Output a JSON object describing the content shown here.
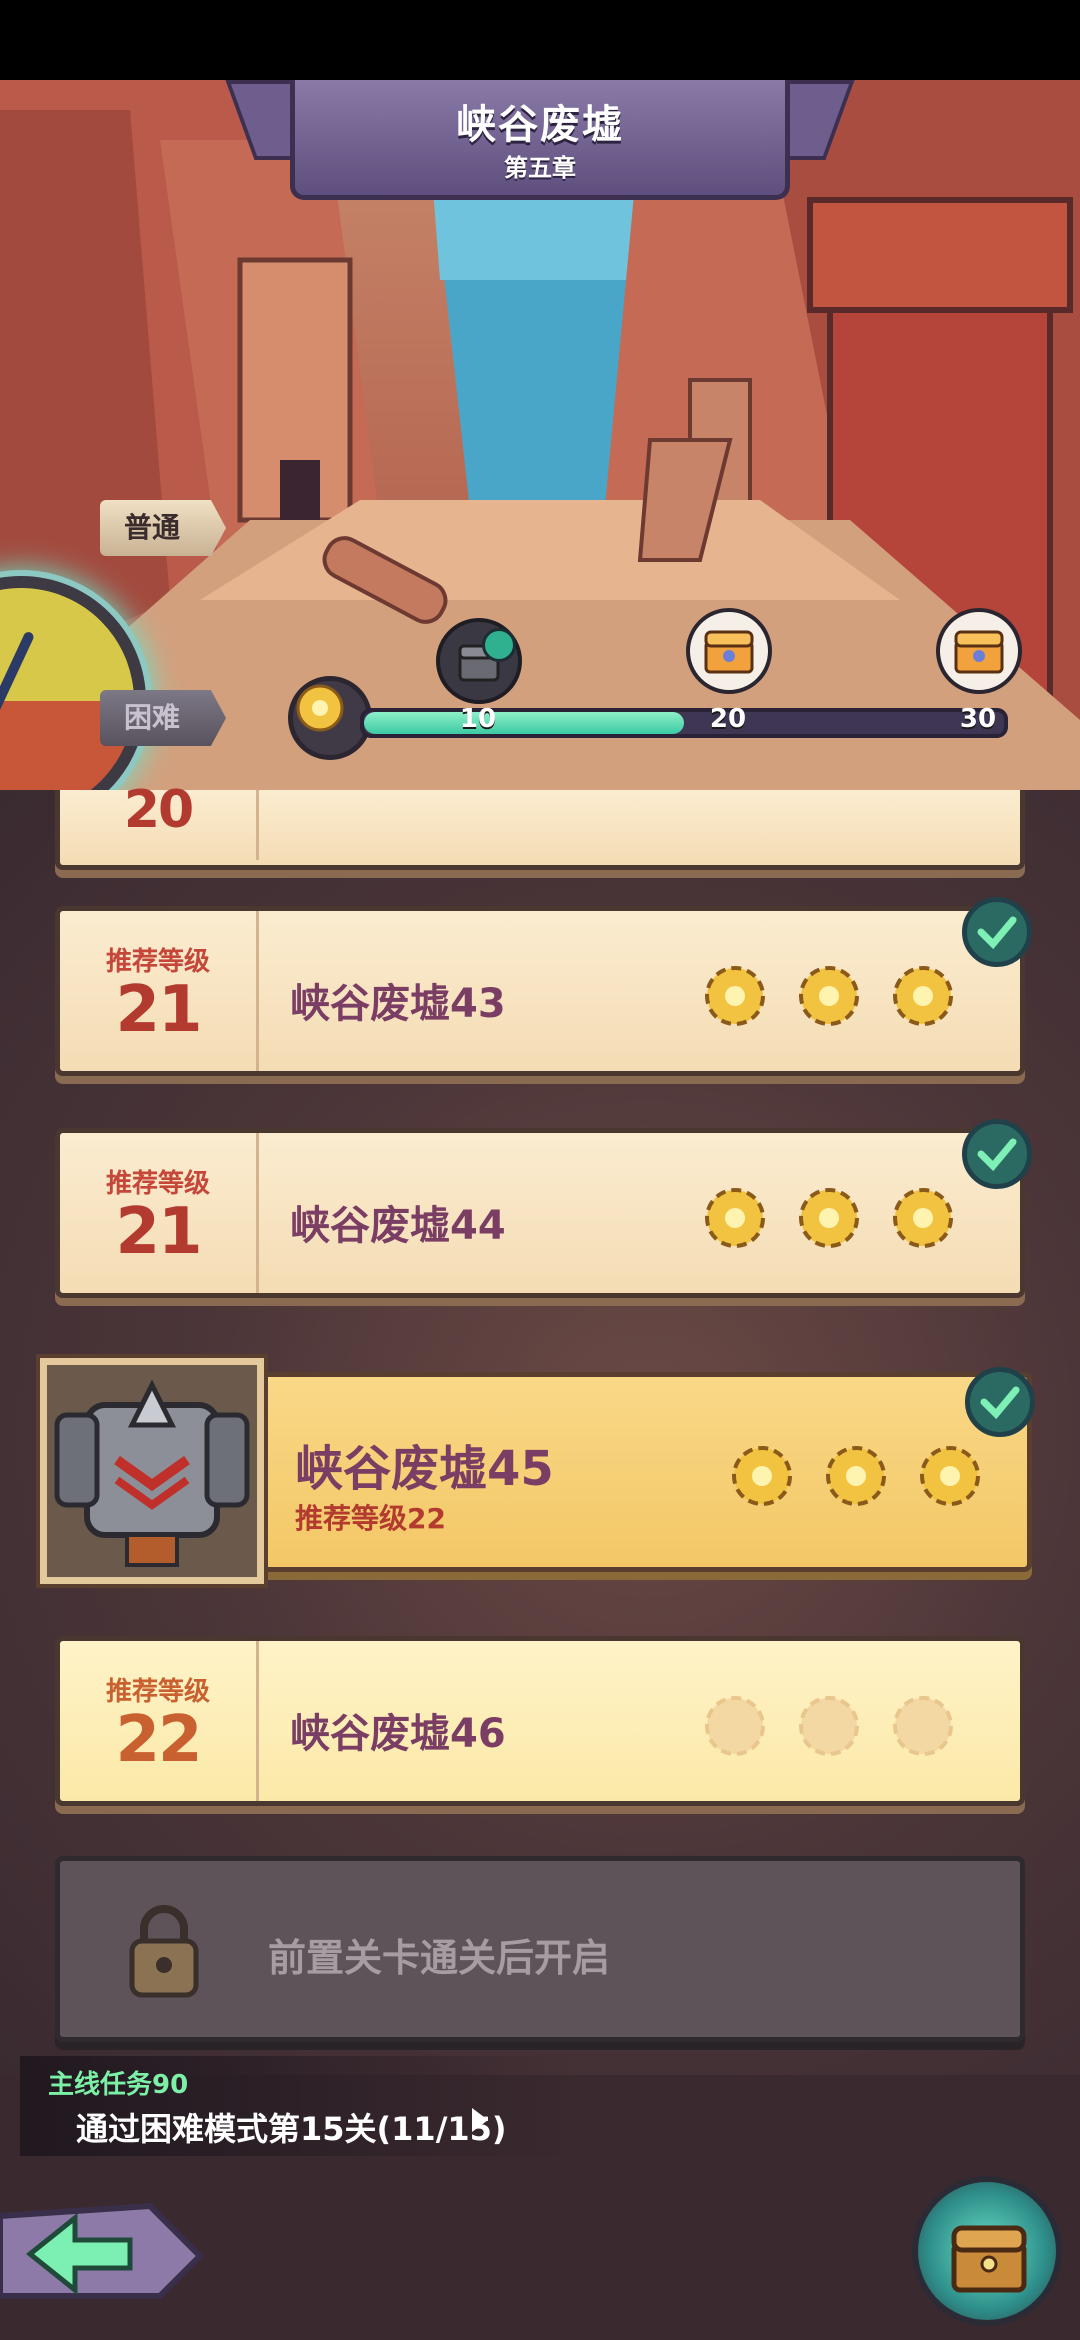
{
  "header": {
    "stage_title": "峡谷废墟",
    "chapter": "第五章"
  },
  "difficulty": {
    "normal_label": "普通",
    "hard_label": "困难",
    "selected": "普通"
  },
  "progress": {
    "current": 15,
    "max": 30,
    "milestones": [
      {
        "value": "10",
        "claimed": true
      },
      {
        "value": "20",
        "claimed": false
      },
      {
        "value": "30",
        "claimed": false
      }
    ]
  },
  "stages": {
    "partial": {
      "level": "20"
    },
    "s43": {
      "rec_label": "推荐等级",
      "level": "21",
      "name": "峡谷废墟43",
      "stars": 3,
      "completed": true
    },
    "s44": {
      "rec_label": "推荐等级",
      "level": "21",
      "name": "峡谷废墟44",
      "stars": 3,
      "completed": true
    },
    "s45": {
      "name": "峡谷废墟45",
      "rec_text": "推荐等级22",
      "stars": 3,
      "completed": true
    },
    "s46": {
      "rec_label": "推荐等级",
      "level": "22",
      "name": "峡谷废墟46",
      "stars": 0,
      "completed": false
    },
    "locked": {
      "text": "前置关卡通关后开启"
    }
  },
  "quest": {
    "title": "主线任务90",
    "description": "通过困难模式第15关(11/15)"
  },
  "colors": {
    "accent_green": "#3cc9a4",
    "card_bg": "#f4dcb4",
    "name_purple": "#7a3d63",
    "level_red": "#b23a2e"
  },
  "icons": [
    "back-arrow-icon",
    "treasure-chest-icon",
    "gear-star-icon",
    "check-icon",
    "lock-icon"
  ]
}
